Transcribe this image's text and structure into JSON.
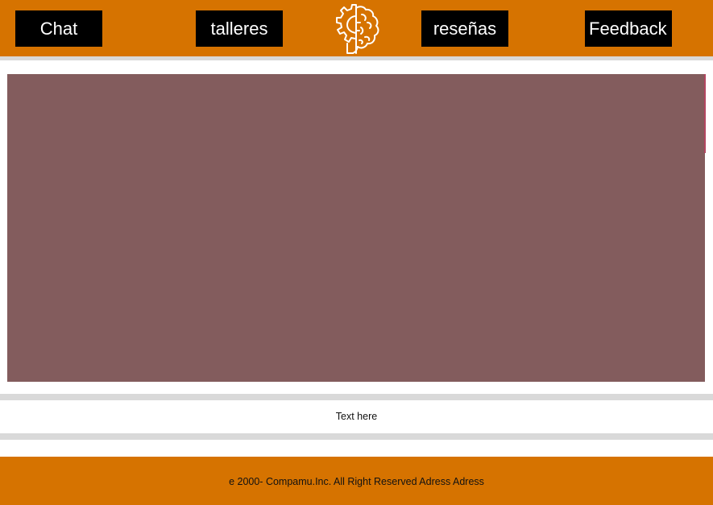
{
  "colors": {
    "header_background": "#d67300",
    "nav_button_background": "#000000",
    "nav_button_text": "#ffffff",
    "hero_background": "#835c5d",
    "divider": "#d9d9d9",
    "footer_background": "#d67300"
  },
  "header": {
    "nav": {
      "chat": "Chat",
      "talleres": "talleres",
      "resenas": "reseñas",
      "feedback": "Feedback"
    },
    "logo_icon": "brain-gear-icon"
  },
  "main": {
    "text": "Text here"
  },
  "footer": {
    "copyright": "e 2000- Compamu.Inc. All Right Reserved Adress Adress"
  }
}
